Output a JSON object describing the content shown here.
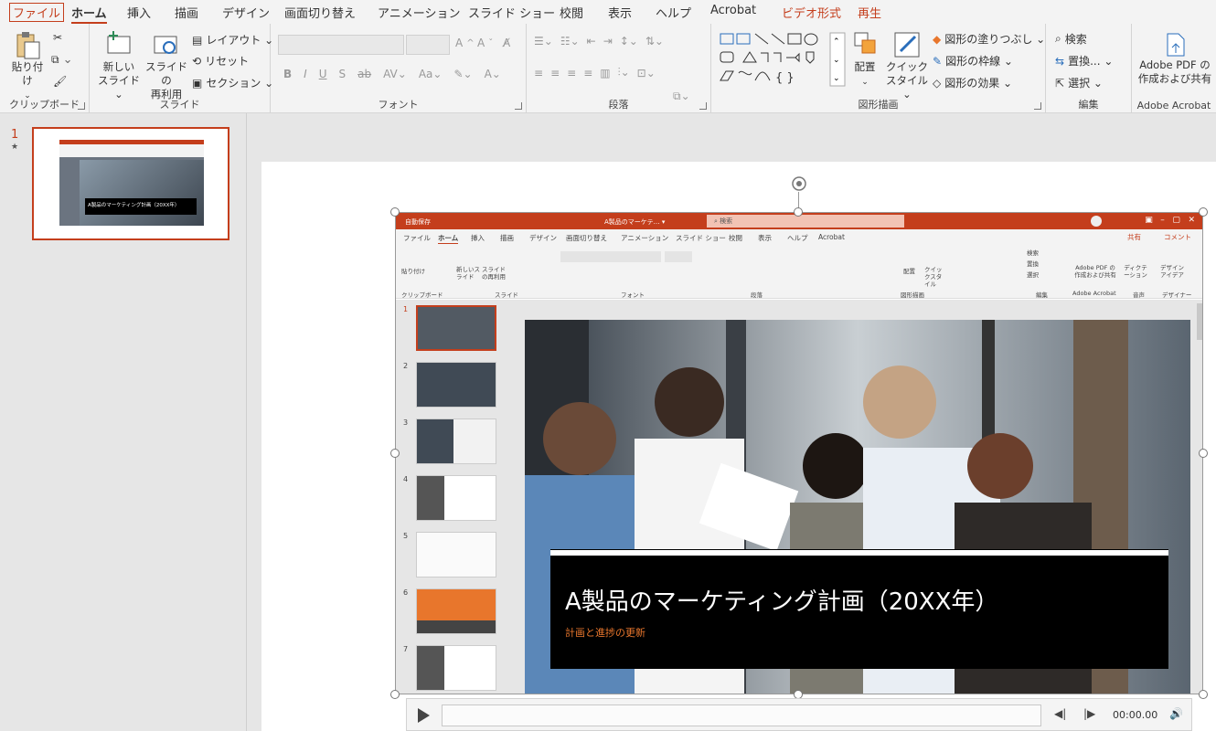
{
  "tabs": [
    "ファイル",
    "ホーム",
    "挿入",
    "描画",
    "デザイン",
    "画面切り替え",
    "アニメーション",
    "スライド ショー",
    "校閲",
    "表示",
    "ヘルプ",
    "Acrobat",
    "ビデオ形式",
    "再生"
  ],
  "ribbon": {
    "paste": "貼り付け",
    "clipboard": "クリップボード",
    "new_slide_1": "新しい",
    "new_slide_2": "スライド ⌄",
    "reuse_1": "スライドの",
    "reuse_2": "再利用",
    "layout": "レイアウト ⌄",
    "reset": "リセット",
    "section": "セクション ⌄",
    "slides_group": "スライド",
    "font_group": "フォント",
    "paragraph_group": "段落",
    "arrange": "配置",
    "quick_style_1": "クイック",
    "quick_style_2": "スタイル ⌄",
    "shape_fill": "図形の塗りつぶし ⌄",
    "shape_outline": "図形の枠線 ⌄",
    "shape_effect": "図形の効果 ⌄",
    "drawing_group": "図形描画",
    "find": "検索",
    "replace": "置換...  ⌄",
    "select": "選択 ⌄",
    "editing_group": "編集",
    "pdf_1": "Adobe PDF の",
    "pdf_2": "作成および共有",
    "acrobat_group": "Adobe Acrobat"
  },
  "thumb": {
    "number": "1",
    "star": "★",
    "title": "A製品のマーケティング計画（20XX年）"
  },
  "video": {
    "inner_title": "A製品のマーケテ… ▾",
    "inner_search": "検索",
    "autosave": "自動保存",
    "inner_tabs": [
      "ファイル",
      "ホーム",
      "挿入",
      "描画",
      "デザイン",
      "画面切り替え",
      "アニメーション",
      "スライド ショー",
      "校閲",
      "表示",
      "ヘルプ",
      "Acrobat"
    ],
    "share": "共有",
    "comment": "コメント",
    "inner_groups": [
      "クリップボード",
      "スライド",
      "フォント",
      "段落",
      "図形描画",
      "編集",
      "Adobe Acrobat",
      "音声",
      "デザイナー"
    ],
    "inner_buttons": [
      "貼り付け",
      "新しいスライド",
      "スライドの再利用",
      "配置",
      "クイックスタイル",
      "検索",
      "置換",
      "選択",
      "Adobe PDF の作成および共有",
      "ディクテーション",
      "デザインアイデア"
    ],
    "thumb_numbers": [
      "1",
      "2",
      "3",
      "4",
      "5",
      "6",
      "7"
    ],
    "slide_title": "A製品のマーケティング計画（20XX年）",
    "slide_subtitle": "計画と進捗の更新"
  },
  "player": {
    "time": "00:00.00"
  }
}
